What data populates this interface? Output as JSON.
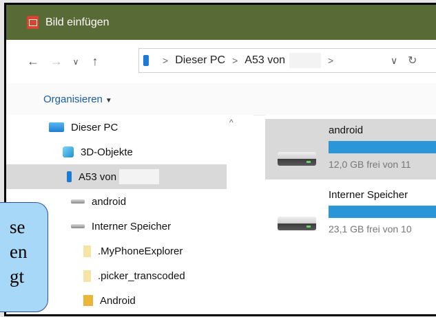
{
  "window": {
    "title": "Bild einfügen"
  },
  "address_bar": {
    "back": "←",
    "forward": "→",
    "recent": "∨",
    "up": "↑",
    "crumbs": [
      "Dieser PC",
      "A53 von"
    ],
    "separator": ">",
    "dropdown": "∨",
    "refresh": "↻"
  },
  "commandbar": {
    "organize_label": "Organisieren",
    "organize_caret": "▼"
  },
  "nav": {
    "items": [
      {
        "label": "Dieser PC",
        "icon": "pc-icon"
      },
      {
        "label": "3D-Objekte",
        "icon": "3d-objects-icon"
      },
      {
        "label": "A53 von",
        "icon": "phone-icon",
        "selected": true
      },
      {
        "label": "android",
        "icon": "drive-icon"
      },
      {
        "label": "Interner Speicher",
        "icon": "drive-icon"
      },
      {
        "label": ".MyPhoneExplorer",
        "icon": "folder-icon"
      },
      {
        "label": ".picker_transcoded",
        "icon": "folder-icon"
      },
      {
        "label": "Android",
        "icon": "folder-icon"
      }
    ],
    "scroll_up": "^"
  },
  "content": {
    "drives": [
      {
        "name": "android",
        "free_text": "12,0 GB frei von 11",
        "selected": true
      },
      {
        "name": "Interner Speicher",
        "free_text": "23,1 GB frei von 10",
        "selected": false
      }
    ]
  },
  "callout": {
    "lines": [
      "se",
      "en",
      "gt"
    ]
  },
  "colors": {
    "titlebar": "#586a35",
    "accent": "#1d7ad6",
    "bar": "#2a96d8",
    "selection": "#d9d9d9"
  }
}
